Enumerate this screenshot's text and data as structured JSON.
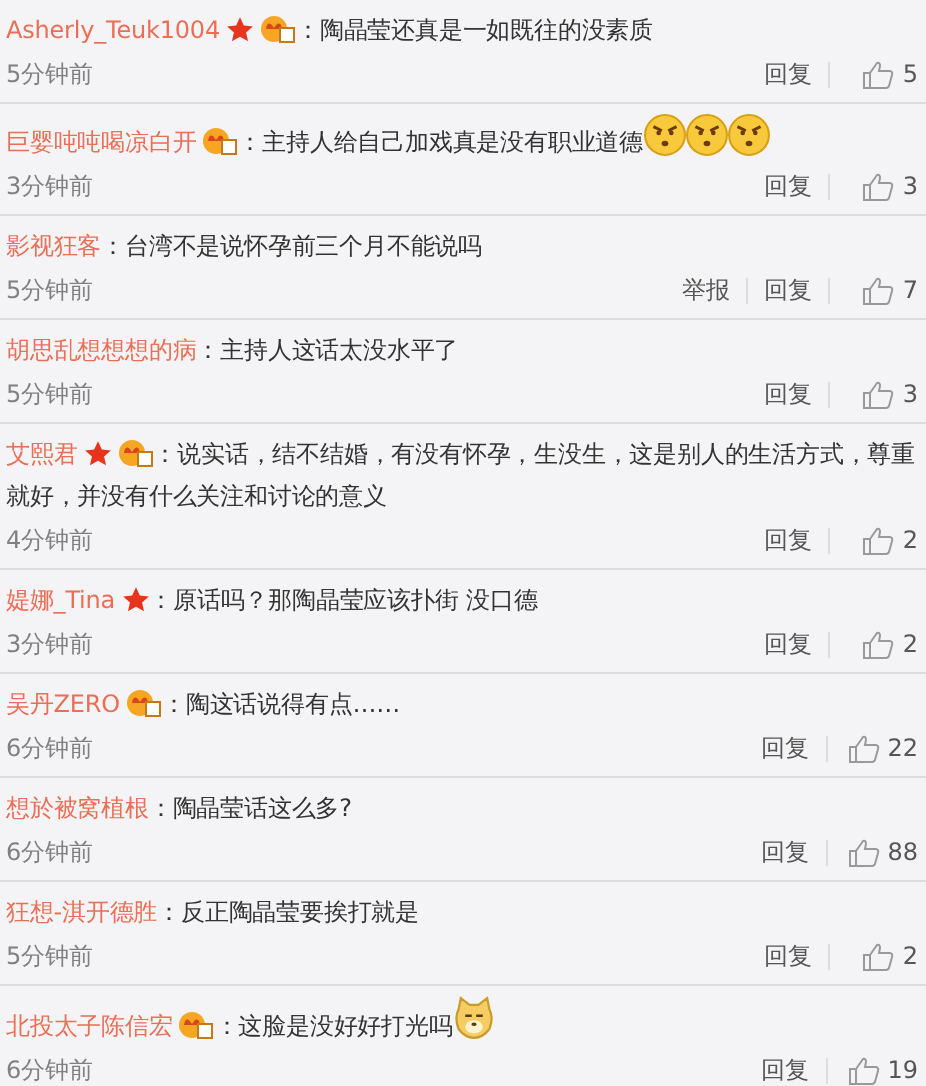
{
  "comments": [
    {
      "name": "Asherly_Teuk1004",
      "badges": [
        {
          "kind": "star"
        },
        {
          "kind": "vip"
        }
      ],
      "text": "：陶晶莹还真是一如既往的没素质",
      "time": "5分钟前",
      "reply": "回复",
      "likes": "5"
    },
    {
      "name": "巨婴吨吨喝凉白开",
      "badges": [
        {
          "kind": "vip"
        }
      ],
      "text": "：主持人给自己加戏真是没有职业道德",
      "emoji": [
        {
          "kind": "angry"
        },
        {
          "kind": "angry"
        },
        {
          "kind": "angry"
        }
      ],
      "time": "3分钟前",
      "reply": "回复",
      "likes": "3"
    },
    {
      "name": "影视狂客",
      "text": "：台湾不是说怀孕前三个月不能说吗",
      "time": "5分钟前",
      "report": "举报",
      "reply": "回复",
      "likes": "7"
    },
    {
      "name": "胡思乱想想想的病",
      "text": "：主持人这话太没水平了",
      "time": "5分钟前",
      "reply": "回复",
      "likes": "3"
    },
    {
      "name": "艾熙君",
      "badges": [
        {
          "kind": "star"
        },
        {
          "kind": "vip"
        }
      ],
      "text": "：说实话，结不结婚，有没有怀孕，生没生，这是别人的生活方式，尊重",
      "text_continued": "就好，并没有什么关注和讨论的意义",
      "time": "4分钟前",
      "reply": "回复",
      "likes": "2"
    },
    {
      "name": "媞娜_Tina",
      "badges": [
        {
          "kind": "star"
        }
      ],
      "text": "：原话吗？那陶晶莹应该扑街 没口德",
      "time": "3分钟前",
      "reply": "回复",
      "likes": "2"
    },
    {
      "name": "吴丹ZERO",
      "badges": [
        {
          "kind": "vip"
        }
      ],
      "text": "：陶这话说得有点……",
      "time": "6分钟前",
      "reply": "回复",
      "likes": "22"
    },
    {
      "name": "想於被窝植根",
      "text": "：陶晶莹话这么多?",
      "time": "6分钟前",
      "reply": "回复",
      "likes": "88"
    },
    {
      "name": "狂想-淇开德胜",
      "text": "：反正陶晶莹要挨打就是",
      "time": "5分钟前",
      "reply": "回复",
      "likes": "2"
    },
    {
      "name": "北投太子陈信宏",
      "badges": [
        {
          "kind": "vip"
        }
      ],
      "text": "：这脸是没好好打光吗",
      "emoji": [
        {
          "kind": "dog"
        }
      ],
      "time": "6分钟前",
      "reply": "回复",
      "likes": "19"
    }
  ]
}
